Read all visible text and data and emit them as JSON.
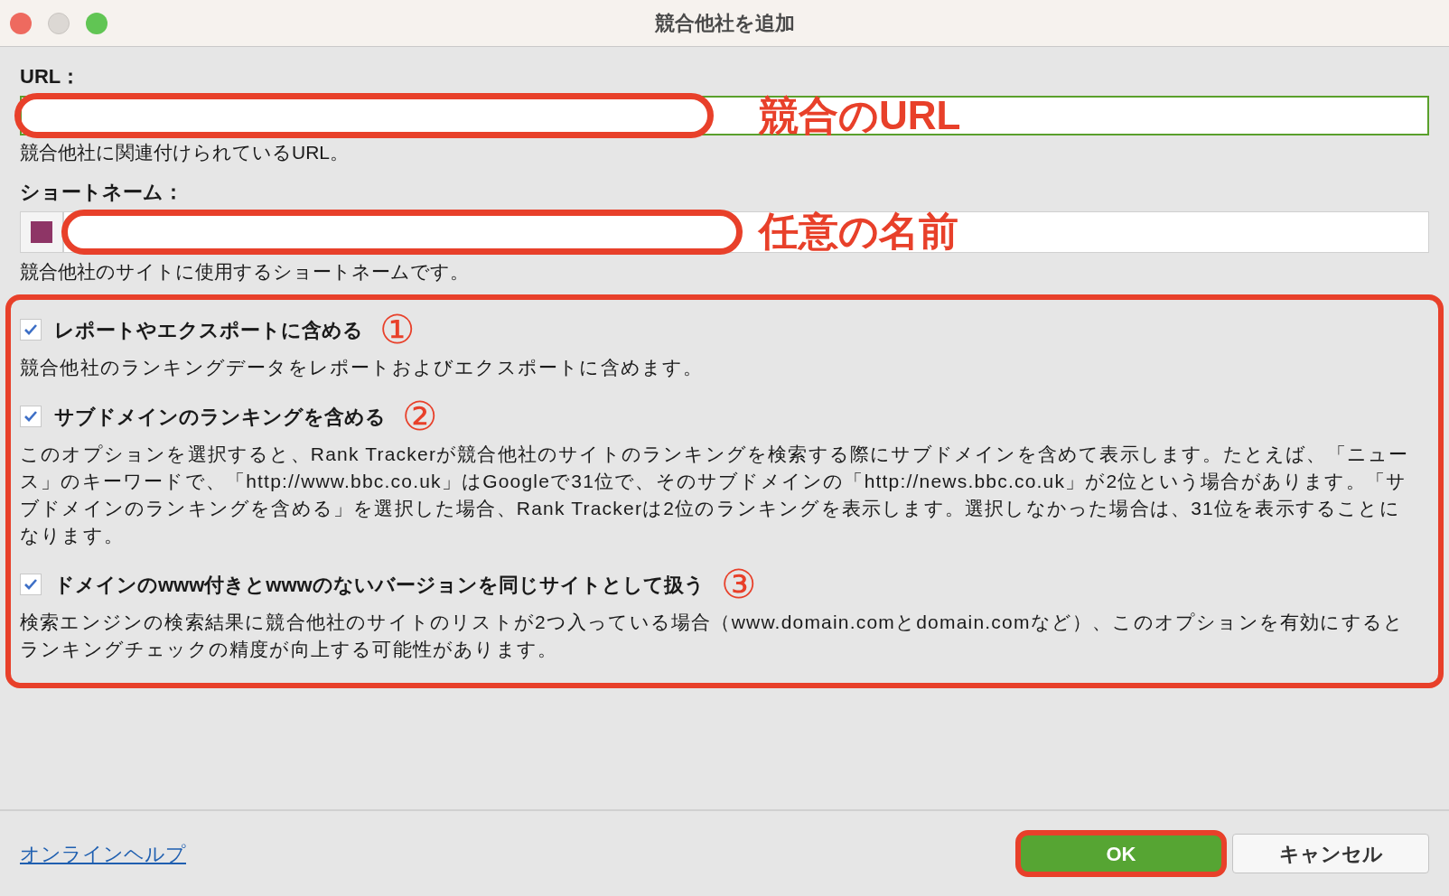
{
  "window": {
    "title": "競合他社を追加"
  },
  "url_field": {
    "label": "URL：",
    "value_highlight": true,
    "help": "競合他社に関連付けられているURL。",
    "annotation": "競合のURL"
  },
  "short_name_field": {
    "label": "ショートネーム：",
    "color": "#8e3566",
    "help": "競合他社のサイトに使用するショートネームです。",
    "annotation": "任意の名前"
  },
  "options": [
    {
      "label": "レポートやエクスポートに含める",
      "checked": true,
      "marker": "①",
      "description": "競合他社のランキングデータをレポートおよびエクスポートに含めます。"
    },
    {
      "label": "サブドメインのランキングを含める",
      "checked": true,
      "marker": "②",
      "description": "このオプションを選択すると、Rank Trackerが競合他社のサイトのランキングを検索する際にサブドメインを含めて表示します。たとえば、「ニュース」のキーワードで、「http://www.bbc.co.uk」はGoogleで31位で、そのサブドメインの「http://news.bbc.co.uk」が2位という場合があります。「サブドメインのランキングを含める」を選択した場合、Rank Trackerは2位のランキングを表示します。選択しなかった場合は、31位を表示することになります。"
    },
    {
      "label": "ドメインのwww付きとwwwのないバージョンを同じサイトとして扱う",
      "checked": true,
      "marker": "③",
      "description": "検索エンジンの検索結果に競合他社のサイトのリストが2つ入っている場合（www.domain.comとdomain.comなど）、このオプションを有効にするとランキングチェックの精度が向上する可能性があります。"
    }
  ],
  "footer": {
    "help_link": "オンラインヘルプ",
    "buttons": [
      {
        "label": "OK",
        "kind": "primary"
      },
      {
        "label": "キャンセル",
        "kind": "secondary"
      }
    ]
  }
}
